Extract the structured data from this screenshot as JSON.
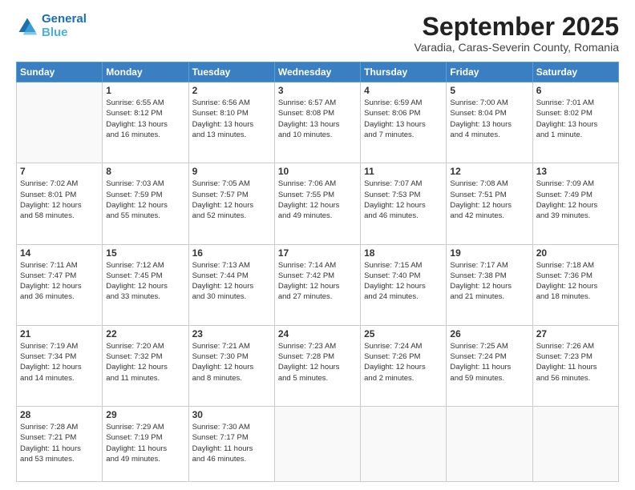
{
  "header": {
    "logo_line1": "General",
    "logo_line2": "Blue",
    "main_title": "September 2025",
    "subtitle": "Varadia, Caras-Severin County, Romania"
  },
  "days_of_week": [
    "Sunday",
    "Monday",
    "Tuesday",
    "Wednesday",
    "Thursday",
    "Friday",
    "Saturday"
  ],
  "weeks": [
    [
      {
        "day": "",
        "info": ""
      },
      {
        "day": "1",
        "info": "Sunrise: 6:55 AM\nSunset: 8:12 PM\nDaylight: 13 hours\nand 16 minutes."
      },
      {
        "day": "2",
        "info": "Sunrise: 6:56 AM\nSunset: 8:10 PM\nDaylight: 13 hours\nand 13 minutes."
      },
      {
        "day": "3",
        "info": "Sunrise: 6:57 AM\nSunset: 8:08 PM\nDaylight: 13 hours\nand 10 minutes."
      },
      {
        "day": "4",
        "info": "Sunrise: 6:59 AM\nSunset: 8:06 PM\nDaylight: 13 hours\nand 7 minutes."
      },
      {
        "day": "5",
        "info": "Sunrise: 7:00 AM\nSunset: 8:04 PM\nDaylight: 13 hours\nand 4 minutes."
      },
      {
        "day": "6",
        "info": "Sunrise: 7:01 AM\nSunset: 8:02 PM\nDaylight: 13 hours\nand 1 minute."
      }
    ],
    [
      {
        "day": "7",
        "info": "Sunrise: 7:02 AM\nSunset: 8:01 PM\nDaylight: 12 hours\nand 58 minutes."
      },
      {
        "day": "8",
        "info": "Sunrise: 7:03 AM\nSunset: 7:59 PM\nDaylight: 12 hours\nand 55 minutes."
      },
      {
        "day": "9",
        "info": "Sunrise: 7:05 AM\nSunset: 7:57 PM\nDaylight: 12 hours\nand 52 minutes."
      },
      {
        "day": "10",
        "info": "Sunrise: 7:06 AM\nSunset: 7:55 PM\nDaylight: 12 hours\nand 49 minutes."
      },
      {
        "day": "11",
        "info": "Sunrise: 7:07 AM\nSunset: 7:53 PM\nDaylight: 12 hours\nand 46 minutes."
      },
      {
        "day": "12",
        "info": "Sunrise: 7:08 AM\nSunset: 7:51 PM\nDaylight: 12 hours\nand 42 minutes."
      },
      {
        "day": "13",
        "info": "Sunrise: 7:09 AM\nSunset: 7:49 PM\nDaylight: 12 hours\nand 39 minutes."
      }
    ],
    [
      {
        "day": "14",
        "info": "Sunrise: 7:11 AM\nSunset: 7:47 PM\nDaylight: 12 hours\nand 36 minutes."
      },
      {
        "day": "15",
        "info": "Sunrise: 7:12 AM\nSunset: 7:45 PM\nDaylight: 12 hours\nand 33 minutes."
      },
      {
        "day": "16",
        "info": "Sunrise: 7:13 AM\nSunset: 7:44 PM\nDaylight: 12 hours\nand 30 minutes."
      },
      {
        "day": "17",
        "info": "Sunrise: 7:14 AM\nSunset: 7:42 PM\nDaylight: 12 hours\nand 27 minutes."
      },
      {
        "day": "18",
        "info": "Sunrise: 7:15 AM\nSunset: 7:40 PM\nDaylight: 12 hours\nand 24 minutes."
      },
      {
        "day": "19",
        "info": "Sunrise: 7:17 AM\nSunset: 7:38 PM\nDaylight: 12 hours\nand 21 minutes."
      },
      {
        "day": "20",
        "info": "Sunrise: 7:18 AM\nSunset: 7:36 PM\nDaylight: 12 hours\nand 18 minutes."
      }
    ],
    [
      {
        "day": "21",
        "info": "Sunrise: 7:19 AM\nSunset: 7:34 PM\nDaylight: 12 hours\nand 14 minutes."
      },
      {
        "day": "22",
        "info": "Sunrise: 7:20 AM\nSunset: 7:32 PM\nDaylight: 12 hours\nand 11 minutes."
      },
      {
        "day": "23",
        "info": "Sunrise: 7:21 AM\nSunset: 7:30 PM\nDaylight: 12 hours\nand 8 minutes."
      },
      {
        "day": "24",
        "info": "Sunrise: 7:23 AM\nSunset: 7:28 PM\nDaylight: 12 hours\nand 5 minutes."
      },
      {
        "day": "25",
        "info": "Sunrise: 7:24 AM\nSunset: 7:26 PM\nDaylight: 12 hours\nand 2 minutes."
      },
      {
        "day": "26",
        "info": "Sunrise: 7:25 AM\nSunset: 7:24 PM\nDaylight: 11 hours\nand 59 minutes."
      },
      {
        "day": "27",
        "info": "Sunrise: 7:26 AM\nSunset: 7:23 PM\nDaylight: 11 hours\nand 56 minutes."
      }
    ],
    [
      {
        "day": "28",
        "info": "Sunrise: 7:28 AM\nSunset: 7:21 PM\nDaylight: 11 hours\nand 53 minutes."
      },
      {
        "day": "29",
        "info": "Sunrise: 7:29 AM\nSunset: 7:19 PM\nDaylight: 11 hours\nand 49 minutes."
      },
      {
        "day": "30",
        "info": "Sunrise: 7:30 AM\nSunset: 7:17 PM\nDaylight: 11 hours\nand 46 minutes."
      },
      {
        "day": "",
        "info": ""
      },
      {
        "day": "",
        "info": ""
      },
      {
        "day": "",
        "info": ""
      },
      {
        "day": "",
        "info": ""
      }
    ]
  ]
}
